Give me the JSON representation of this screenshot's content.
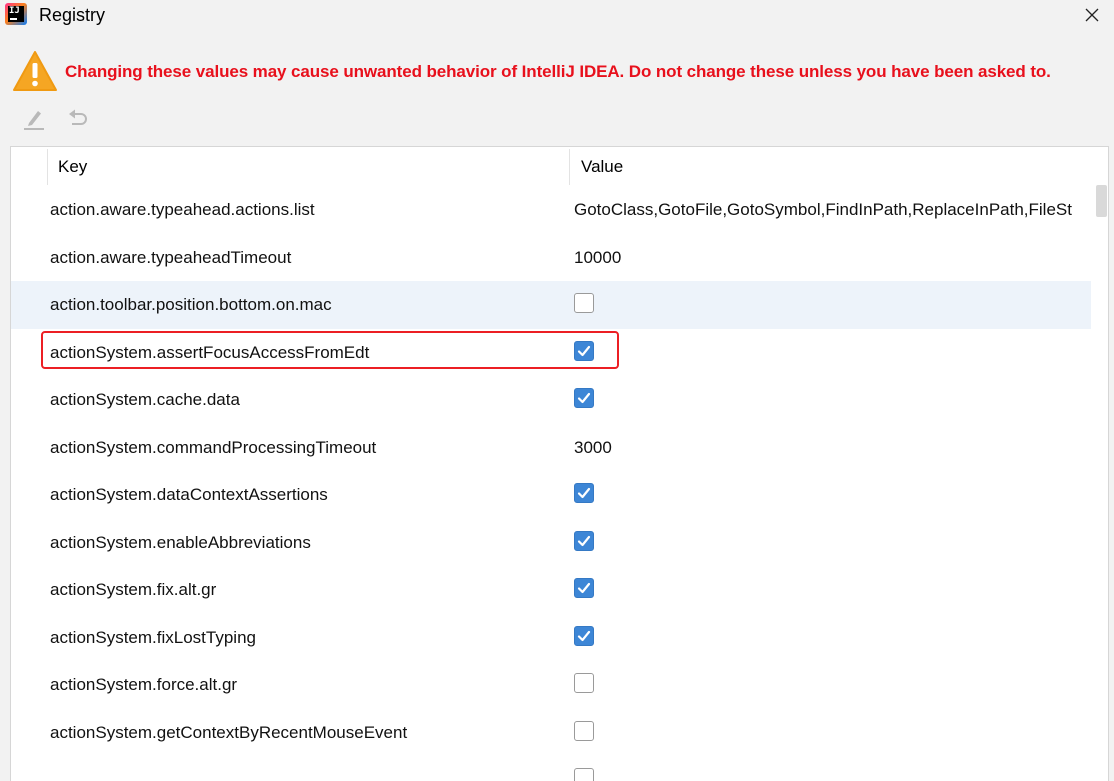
{
  "window": {
    "title": "Registry",
    "app_icon_label": "IJ"
  },
  "warning": {
    "text": "Changing these values may cause unwanted behavior of IntelliJ IDEA. Do not change these unless you have been asked to.",
    "color": "#e8101c"
  },
  "toolbar": {
    "edit_icon": "edit-icon",
    "revert_icon": "revert-icon"
  },
  "table": {
    "headers": {
      "key": "Key",
      "value": "Value"
    },
    "rows": [
      {
        "key": "action.aware.typeahead.actions.list",
        "type": "text",
        "value": "GotoClass,GotoFile,GotoSymbol,FindInPath,ReplaceInPath,FileSt"
      },
      {
        "key": "action.aware.typeaheadTimeout",
        "type": "text",
        "value": "10000"
      },
      {
        "key": "action.toolbar.position.bottom.on.mac",
        "type": "checkbox",
        "checked": false,
        "selected": true
      },
      {
        "key": "actionSystem.assertFocusAccessFromEdt",
        "type": "checkbox",
        "checked": true,
        "highlighted": true
      },
      {
        "key": "actionSystem.cache.data",
        "type": "checkbox",
        "checked": true
      },
      {
        "key": "actionSystem.commandProcessingTimeout",
        "type": "text",
        "value": "3000"
      },
      {
        "key": "actionSystem.dataContextAssertions",
        "type": "checkbox",
        "checked": true
      },
      {
        "key": "actionSystem.enableAbbreviations",
        "type": "checkbox",
        "checked": true
      },
      {
        "key": "actionSystem.fix.alt.gr",
        "type": "checkbox",
        "checked": true
      },
      {
        "key": "actionSystem.fixLostTyping",
        "type": "checkbox",
        "checked": true
      },
      {
        "key": "actionSystem.force.alt.gr",
        "type": "checkbox",
        "checked": false
      },
      {
        "key": "actionSystem.getContextByRecentMouseEvent",
        "type": "checkbox",
        "checked": false
      },
      {
        "key": "",
        "type": "checkbox",
        "checked": false
      }
    ]
  },
  "colors": {
    "checkbox_on": "#3d86d6",
    "selected_row": "#edf3fa",
    "highlight_border": "#ec1f24"
  }
}
